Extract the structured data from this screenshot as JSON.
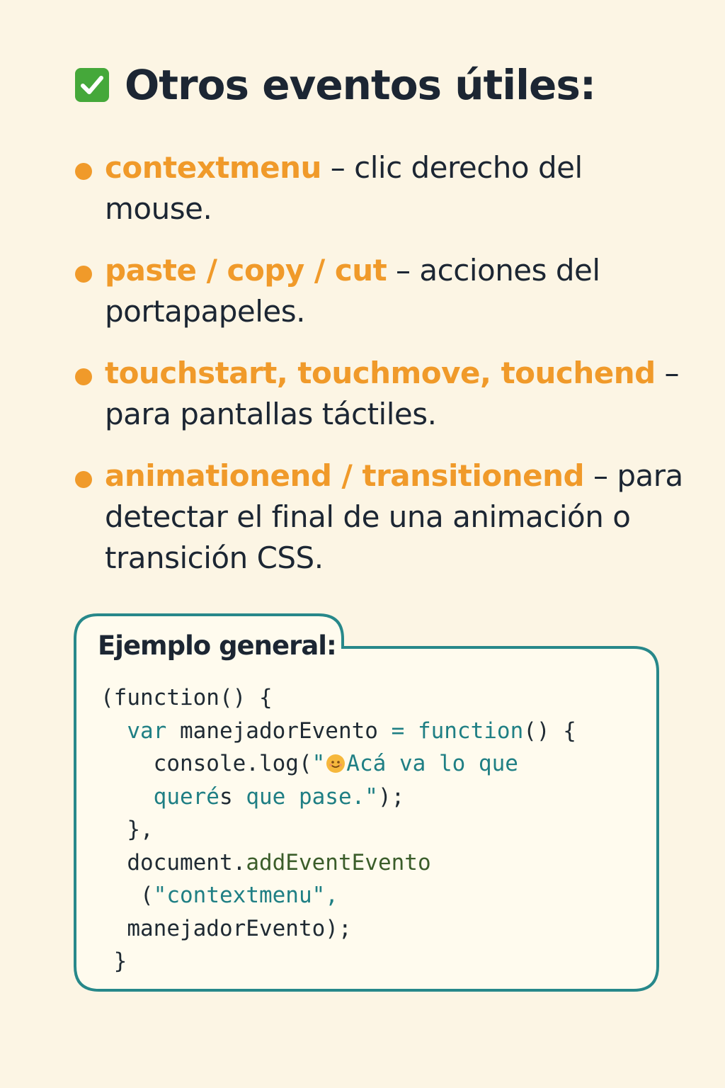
{
  "title": {
    "text": "Otros eventos útiles:",
    "icon": "check-mark-button-icon",
    "icon_color": "#45a83a"
  },
  "events": [
    {
      "name": "contextmenu",
      "description": " – clic derecho del mouse."
    },
    {
      "name": "paste / copy / cut",
      "description": " – acciones del portapapeles."
    },
    {
      "name": "touchstart, touchmove, touchend",
      "description": " – para pantallas táctiles."
    },
    {
      "name": "animationend / transitionend",
      "description": " – para detectar el final de una animación o transición CSS."
    }
  ],
  "example": {
    "title": "Ejemplo general:",
    "code": {
      "line1": "(function() {",
      "var_kw": "var",
      "var_name": " manejadorEvento ",
      "eq": "=",
      "function_kw": " function",
      "fn_tail": "() {",
      "console_log": "console.log(",
      "string_part1": "\"",
      "emoji": "smiling-face-icon",
      "string_part2": "Acá va lo que",
      "string_part3": "queré",
      "string_part3_tail": "s",
      "string_part4": " que pase.\"",
      "close_call": ");",
      "close_fn": "},",
      "document": "document.",
      "add_event": "addEventEvento",
      "open_paren": "(",
      "event_string": "\"contextmenu\",",
      "handler": "manejadorEvento);",
      "closing_brace": "}"
    }
  },
  "colors": {
    "background": "#fcf5e4",
    "accent_orange": "#f09a2a",
    "accent_teal": "#1f7f84",
    "text_dark": "#1c2633"
  }
}
